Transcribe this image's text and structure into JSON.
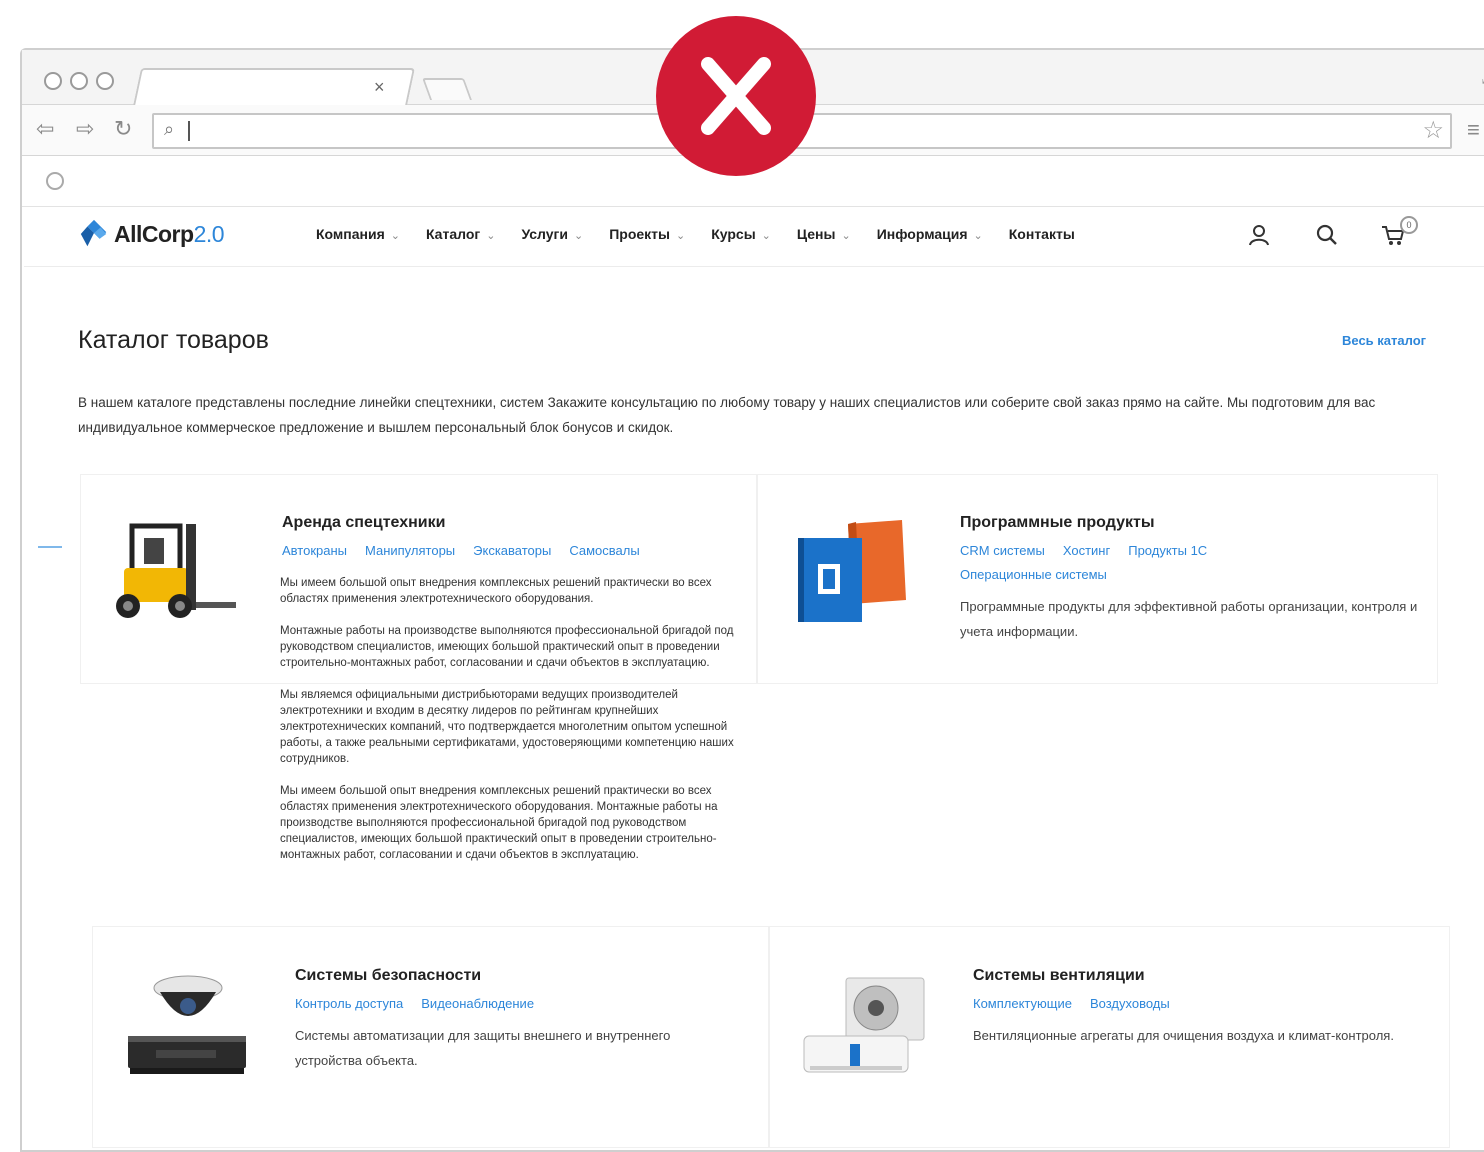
{
  "browser": {
    "tab_close": "×",
    "url_value": ""
  },
  "header": {
    "logo_text": "AllCorp",
    "logo_version": "2.0",
    "nav": [
      {
        "label": "Компания"
      },
      {
        "label": "Каталог"
      },
      {
        "label": "Услуги"
      },
      {
        "label": "Проекты"
      },
      {
        "label": "Курсы"
      },
      {
        "label": "Цены"
      },
      {
        "label": "Информация"
      },
      {
        "label": "Контакты"
      }
    ],
    "cart_count": "0"
  },
  "main": {
    "title": "Каталог товаров",
    "all_link": "Весь каталог",
    "intro": "В нашем каталоге представлены последние линейки спецтехники, систем Закажите консультацию по любому товару у наших специалистов или соберите свой заказ прямо на сайте. Мы подготовим для вас индивидуальное коммерческое предложение и вышлем персональный блок бонусов и скидок."
  },
  "cards": [
    {
      "title": "Аренда спецтехники",
      "links": [
        "Автокраны",
        "Манипуляторы",
        "Экскаваторы",
        "Самосвалы"
      ],
      "paragraphs": [
        "Мы имеем большой опыт внедрения комплексных решений практически во всех областях применения электротехнического оборудования.",
        "Монтажные работы на производстве выполняются профессиональной бригадой под руководством специалистов, имеющих большой практический опыт в проведении строительно-монтажных работ, согласовании и сдачи объектов в эксплуатацию.",
        "Мы являемся официальными дистрибьюторами ведущих производителей электротехники и входим в десятку лидеров по рейтингам крупнейших электротехнических компаний, что подтверждается многолетним опытом успешной работы, а также реальными сертификатами, удостоверяющими компетенцию наших сотрудников.",
        "Мы имеем большой опыт внедрения комплексных решений практически во всех областях применения электротехнического оборудования. Монтажные работы на производстве выполняются профессиональной бригадой под руководством специалистов, имеющих большой практический опыт в проведении строительно-монтажных работ, согласовании и сдачи объектов в эксплуатацию."
      ]
    },
    {
      "title": "Программные продукты",
      "links": [
        "CRM системы",
        "Хостинг",
        "Продукты 1С",
        "Операционные системы"
      ],
      "description": "Программные продукты для эффективной работы организации, контроля и учета информации."
    },
    {
      "title": "Системы безопасности",
      "links": [
        "Контроль доступа",
        "Видеонаблюдение"
      ],
      "description": "Системы автоматизации для защиты внешнего и внутреннего устройства объекта."
    },
    {
      "title": "Системы вентиляции",
      "links": [
        "Комплектующие",
        "Воздуховоды"
      ],
      "description": "Вентиляционные агрегаты для очищения воздуха и климат-контроля."
    }
  ],
  "colors": {
    "accent": "#2d86d9",
    "error_badge": "#d11b35"
  }
}
